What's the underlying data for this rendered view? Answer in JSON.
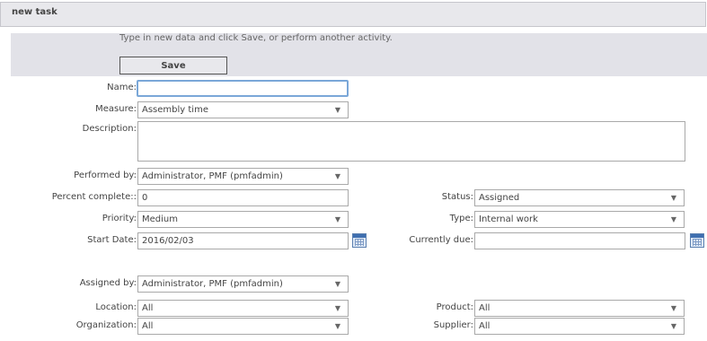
{
  "header": {
    "title": "new task"
  },
  "info": {
    "text": "Type in new data and click Save, or perform another activity."
  },
  "toolbar": {
    "save_label": "Save"
  },
  "form": {
    "name": {
      "label": "Name:",
      "value": ""
    },
    "measure": {
      "label": "Measure:",
      "value": "Assembly time"
    },
    "description": {
      "label": "Description:",
      "value": ""
    },
    "performed_by": {
      "label": "Performed by:",
      "value": "Administrator, PMF (pmfadmin)"
    },
    "percent_complete": {
      "label": "Percent complete::",
      "value": "0"
    },
    "status": {
      "label": "Status:",
      "value": "Assigned"
    },
    "priority": {
      "label": "Priority:",
      "value": "Medium"
    },
    "type": {
      "label": "Type:",
      "value": "Internal work"
    },
    "start_date": {
      "label": "Start Date:",
      "value": "2016/02/03"
    },
    "currently_due": {
      "label": "Currently due:",
      "value": ""
    },
    "assigned_by": {
      "label": "Assigned by:",
      "value": "Administrator, PMF (pmfadmin)"
    },
    "location": {
      "label": "Location:",
      "value": "All"
    },
    "product": {
      "label": "Product:",
      "value": "All"
    },
    "organization": {
      "label": "Organization:",
      "value": "All"
    },
    "supplier": {
      "label": "Supplier:",
      "value": "All"
    }
  },
  "icons": {
    "calendar": "calendar-icon",
    "dropdown": "chevron-down-icon"
  },
  "colors": {
    "header_bg": "#e8e8ec",
    "panel_bg": "#e2e2e8",
    "focus_border": "#7aa7d8"
  }
}
